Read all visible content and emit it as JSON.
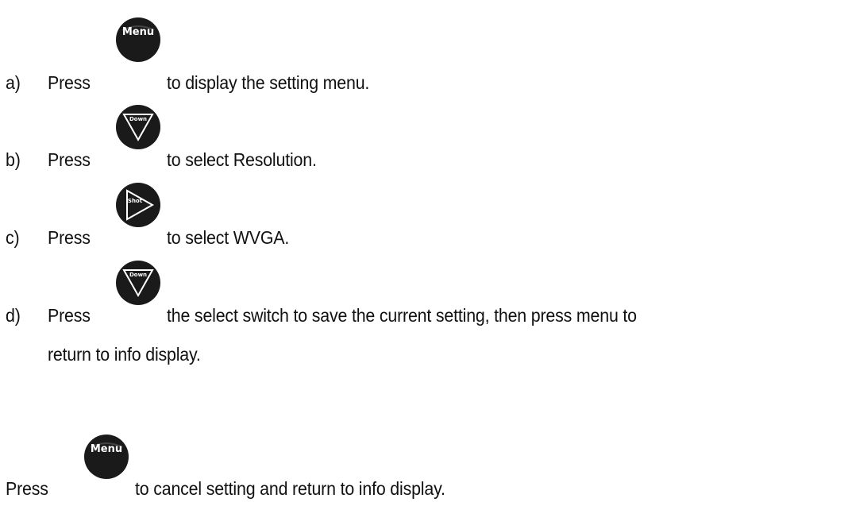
{
  "steps": [
    {
      "marker": "a)",
      "press": "Press",
      "button": "Menu",
      "text": "to display the setting menu."
    },
    {
      "marker": "b)",
      "press": "Press",
      "button": "Down",
      "text": "to select Resolution."
    },
    {
      "marker": "c)",
      "press": "Press",
      "button": "Shot",
      "text": "to select WVGA."
    },
    {
      "marker": "d)",
      "press": "Press",
      "button": "Down",
      "text": "the select switch to save the current setting, then press menu to",
      "text_cont": "return to info display."
    }
  ],
  "footer": {
    "press": "Press",
    "button": "Menu",
    "text": "to cancel setting and return to info display."
  },
  "icons": {
    "menu": "menu-button-icon",
    "down": "down-button-icon",
    "shot": "shot-button-icon"
  }
}
